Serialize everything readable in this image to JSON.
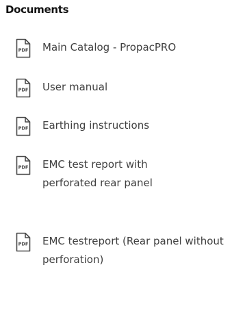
{
  "section": {
    "title": "Documents"
  },
  "icons": {
    "pdf": "pdf-file-icon",
    "icon_text": "PDF",
    "icon_color": "#4a4a4a"
  },
  "documents": [
    {
      "label": "Main Catalog - PropacPRO"
    },
    {
      "label": "User manual"
    },
    {
      "label": "Earthing instructions"
    },
    {
      "label": "EMC test report with perforated rear panel"
    },
    {
      "label": "EMC testreport (Rear panel without perforation)"
    }
  ]
}
